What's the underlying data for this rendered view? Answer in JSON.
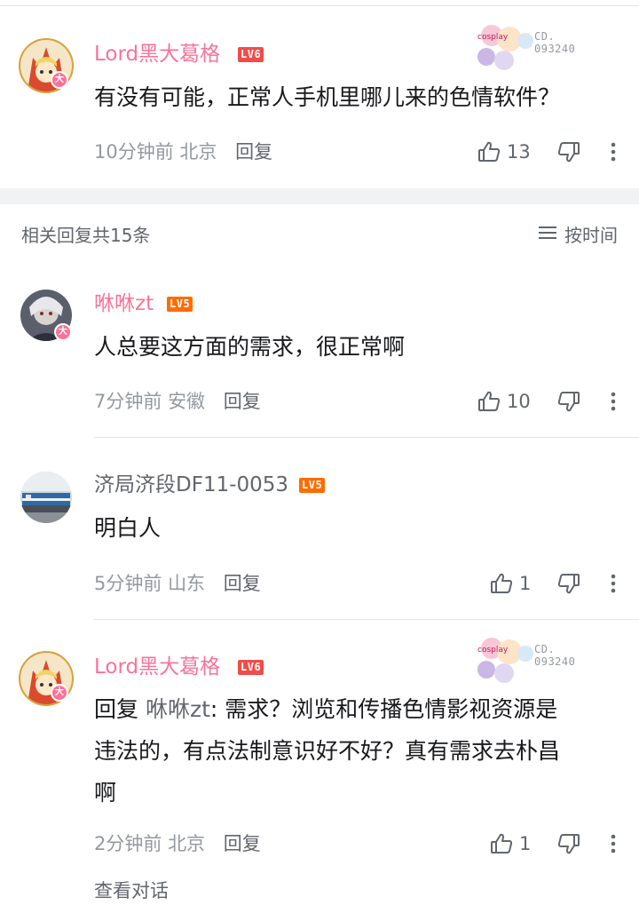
{
  "comments": [
    {
      "user": "Lord黑大葛格",
      "level": "LV6",
      "badge": "大",
      "fan_card_number": "CD.\n093240",
      "text": "有没有可能，正常人手机里哪儿来的色情软件？",
      "time": "10分钟前",
      "location": "北京",
      "reply_label": "回复",
      "likes": "13"
    }
  ],
  "section": {
    "title": "相关回复共15条",
    "sort_label": "按时间"
  },
  "replies": [
    {
      "user": "咻咻zt",
      "level": "LV5",
      "badge": "大",
      "text": "人总要这方面的需求，很正常啊",
      "time": "7分钟前",
      "location": "安徽",
      "reply_label": "回复",
      "likes": "10"
    },
    {
      "user": "济局济段DF11-0053",
      "level": "LV5",
      "text": "明白人",
      "time": "5分钟前",
      "location": "山东",
      "reply_label": "回复",
      "likes": "1"
    },
    {
      "user": "Lord黑大葛格",
      "level": "LV6",
      "badge": "大",
      "fan_card_number": "CD.\n093240",
      "reply_prefix": "回复",
      "reply_target": "咻咻zt",
      "text_line1": ": 需求？浏览和传播色情影视资源是",
      "text_line2": "违法的，有点法制意识好不好？真有需求去朴昌",
      "text_line3": "啊",
      "time": "2分钟前",
      "location": "北京",
      "reply_label": "回复",
      "likes": "1",
      "view_conversation": "查看对话"
    }
  ],
  "colors": {
    "username_vip": "#fb7299",
    "username_normal": "#61666d",
    "lv6": "#f04c49",
    "lv5": "#ff6c00",
    "meta": "#9499a0"
  }
}
